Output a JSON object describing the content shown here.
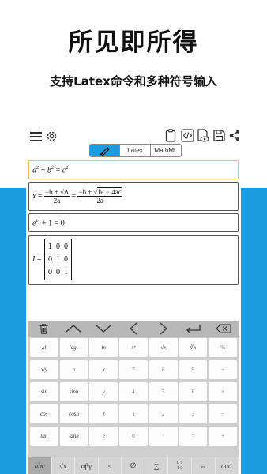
{
  "promo": {
    "title": "所见即所得",
    "subtitle": "支持Latex命令和多种符号输入"
  },
  "toolbar": {
    "icons": [
      "menu-icon",
      "gear-icon",
      "clipboard-icon",
      "code-icon",
      "doc-preview-icon",
      "save-icon",
      "share-icon"
    ]
  },
  "tabs": [
    {
      "label": "",
      "icon": "pen-icon",
      "active": true
    },
    {
      "label": "Latex",
      "active": false
    },
    {
      "label": "MathML",
      "active": false
    }
  ],
  "colors": {
    "accent": "#1b9be0",
    "highlight_border": "#e8c06a",
    "keyboard_bg": "#cfcfcf"
  },
  "formulas": {
    "f1": {
      "a": "a",
      "plus": " + ",
      "b": "b",
      "eq": " = ",
      "c": "c",
      "exp": "2"
    },
    "f2": {
      "lhs": "x",
      "eq": " = ",
      "num1": "−b ± √Δ",
      "den1": "2a",
      "num2_pre": "−b ± ",
      "num2_rad": "b² − 4ac",
      "den2": "2a"
    },
    "f3": {
      "base": "e",
      "exp": "iπ",
      "rest": " + 1 = 0"
    },
    "f4": {
      "lhs": "I",
      "eq": " = ",
      "rows": [
        [
          "1",
          "0",
          "0"
        ],
        [
          "0",
          "1",
          "0"
        ],
        [
          "0",
          "0",
          "1"
        ]
      ]
    }
  },
  "keyboard": {
    "nav": [
      "trash-icon",
      "up-arrow-icon",
      "down-arrow-icon",
      "left-arrow-icon",
      "right-arrow-icon",
      "enter-icon",
      "backspace-icon"
    ],
    "keys": [
      [
        "x!",
        "logₙ",
        "ln",
        "xʸ",
        "√x",
        "∛x",
        "%"
      ],
      [
        "x/y",
        "π",
        "x",
        "7",
        "8",
        "9",
        "÷"
      ],
      [
        "sin",
        "sinh",
        "y",
        "4",
        "5",
        "6",
        "×"
      ],
      [
        "cos",
        "cosh",
        "z",
        "1",
        "2",
        "3",
        "−"
      ],
      [
        "tan",
        "tanh",
        "e",
        "0",
        "·",
        "=",
        "+"
      ]
    ],
    "functions": [
      "abc",
      "√x",
      "αβγ",
      "≤",
      "∅",
      "∑",
      "0 1\n1 0",
      "⇔",
      "ooo"
    ]
  }
}
